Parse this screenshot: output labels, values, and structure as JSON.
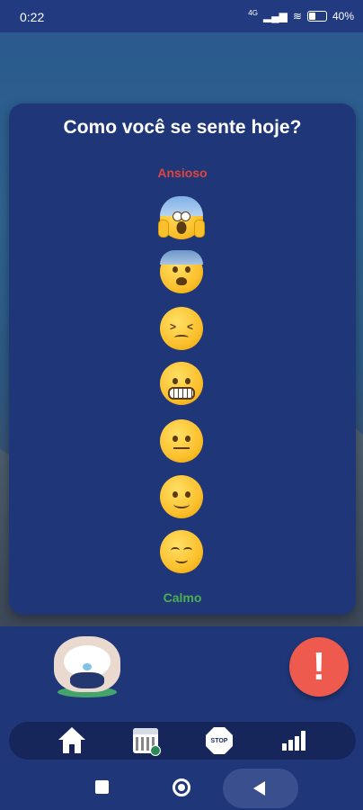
{
  "status_bar": {
    "time": "0:22",
    "network": "4G",
    "battery": "40%"
  },
  "card": {
    "title": "Como você se sente hoje?",
    "top_label": "Ansioso",
    "bottom_label": "Calmo",
    "top_label_color": "#e0443f",
    "bottom_label_color": "#4caf50",
    "options": [
      {
        "icon": "screaming-face-icon"
      },
      {
        "icon": "anxious-face-icon"
      },
      {
        "icon": "confounded-face-icon"
      },
      {
        "icon": "grimacing-face-icon"
      },
      {
        "icon": "neutral-face-icon"
      },
      {
        "icon": "slightly-smiling-face-icon"
      },
      {
        "icon": "relieved-face-icon"
      }
    ]
  },
  "actions": {
    "mascot_icon": "owl-mascot-icon",
    "alert_label": "!",
    "alert_color": "#ee5a4e"
  },
  "tabs": [
    {
      "icon": "home-icon"
    },
    {
      "icon": "calendar-icon"
    },
    {
      "icon": "stop-sign-icon",
      "text": "STOP"
    },
    {
      "icon": "bar-chart-icon"
    }
  ],
  "nav": [
    "recent-apps-icon",
    "home-circle-icon",
    "back-icon"
  ],
  "colors": {
    "background": "#1f3779",
    "tab_bar": "#17265a"
  }
}
